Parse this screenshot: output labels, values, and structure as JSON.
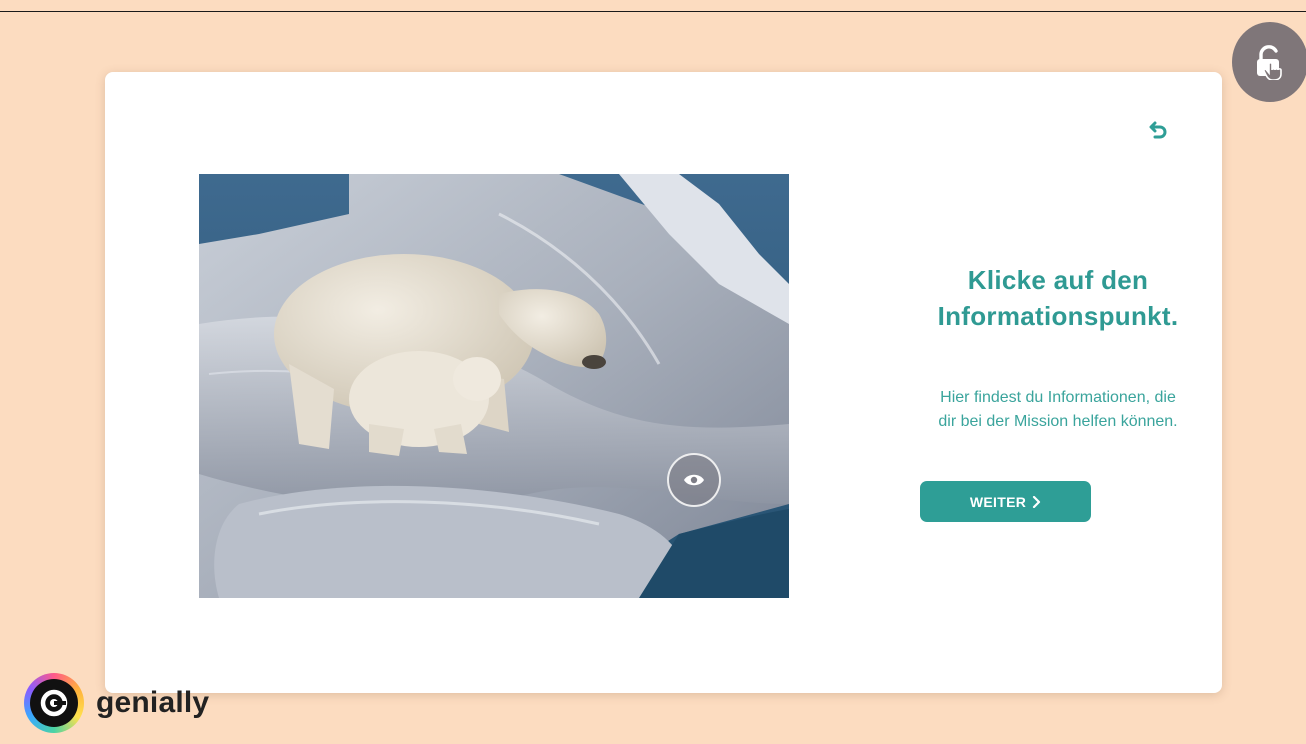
{
  "slide": {
    "heading_line1": "Klicke auf den",
    "heading_line2": "Informationspunkt.",
    "description_line1": "Hier findest du Informationen, die",
    "description_line2": "dir bei der Mission helfen können.",
    "next_button_label": "WEITER",
    "next_button_icon": "chevron-right-icon",
    "back_icon": "undo-arrow-icon",
    "info_point_icon": "eye-icon",
    "image_subject": "polar-bear-photo"
  },
  "overlay": {
    "lock_icon": "unlock-touch-icon"
  },
  "brand": {
    "name": "genially",
    "logo_icon": "genially-logo-icon"
  },
  "colors": {
    "background": "#fcdcc0",
    "accent": "#2e9e96",
    "card": "#ffffff",
    "lock_button": "#7f7679"
  }
}
